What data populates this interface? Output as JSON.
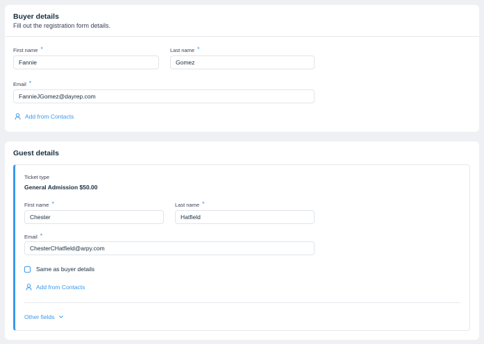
{
  "buyer": {
    "title": "Buyer details",
    "subtitle": "Fill out the registration form details.",
    "first_name_label": "First name",
    "first_name_value": "Fannie",
    "last_name_label": "Last name",
    "last_name_value": "Gomez",
    "email_label": "Email",
    "email_value": "FannieJGomez@dayrep.com",
    "required_mark": "*",
    "add_contacts_label": "Add from Contacts",
    "add_contacts_icon": "person-icon"
  },
  "guest": {
    "title": "Guest details",
    "ticket_type_label": "Ticket type",
    "ticket_type_value": "General Admission $50.00",
    "first_name_label": "First name",
    "first_name_value": "Chester",
    "last_name_label": "Last name",
    "last_name_value": "Hatfield",
    "email_label": "Email",
    "email_value": "ChesterCHatfield@arpy.com",
    "required_mark": "*",
    "same_as_buyer_label": "Same as buyer details",
    "same_as_buyer_checked": false,
    "add_contacts_label": "Add from Contacts",
    "add_contacts_icon": "person-icon",
    "other_fields_label": "Other fields",
    "other_fields_icon": "chevron-down-icon"
  },
  "colors": {
    "accent": "#3899ec",
    "background": "#eef0f3",
    "text": "#162d3d"
  }
}
